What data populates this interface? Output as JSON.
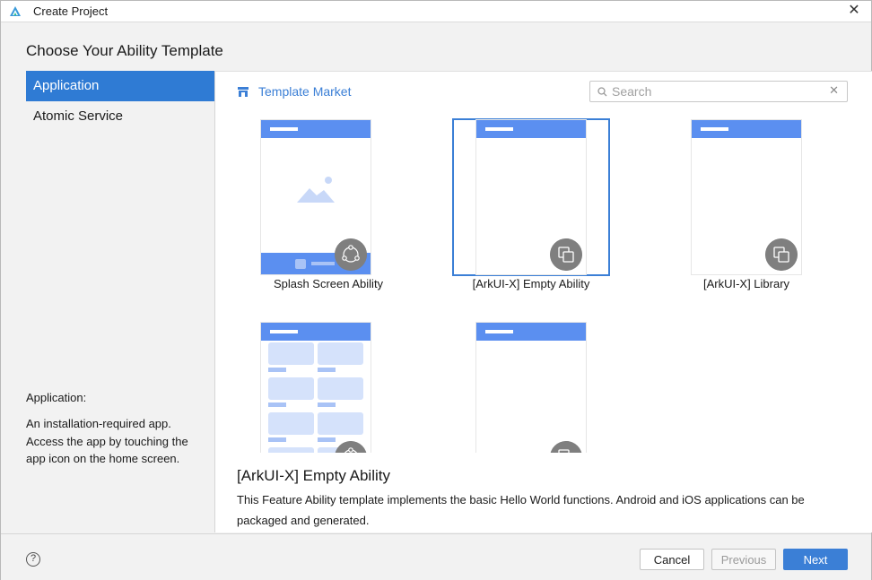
{
  "window": {
    "title": "Create Project"
  },
  "heading": "Choose Your Ability Template",
  "sidebar": {
    "items": [
      {
        "label": "Application",
        "active": true
      },
      {
        "label": "Atomic Service",
        "active": false
      }
    ],
    "description_title": "Application:",
    "description": "An installation-required app. Access the app by touching the app icon on the home screen."
  },
  "content": {
    "market_label": "Template Market",
    "search": {
      "placeholder": "Search",
      "value": ""
    },
    "templates": [
      {
        "label": "Splash Screen Ability",
        "selected": false
      },
      {
        "label": "[ArkUI-X] Empty Ability",
        "selected": true
      },
      {
        "label": "[ArkUI-X] Library",
        "selected": false
      },
      {
        "label": "",
        "selected": false
      },
      {
        "label": "",
        "selected": false
      }
    ],
    "detail": {
      "title": "[ArkUI-X] Empty Ability",
      "description": "This Feature Ability template implements the basic Hello World functions. Android and iOS applications can be packaged and generated."
    }
  },
  "footer": {
    "help_icon": "?",
    "cancel_label": "Cancel",
    "previous_label": "Previous",
    "next_label": "Next"
  },
  "colors": {
    "accent": "#3b7fd6",
    "sidebar_active": "#2f7bd4",
    "thumb_header": "#5b8ff0"
  }
}
